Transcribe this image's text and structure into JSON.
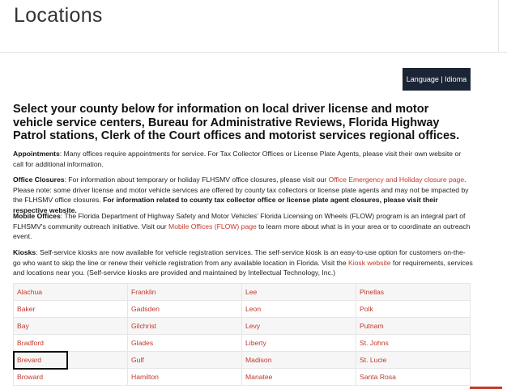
{
  "page": {
    "title": "Locations"
  },
  "language_button": {
    "label": "Language | Idioma"
  },
  "intro_heading": "Select your county below for information on local driver license and motor vehicle service centers, Bureau for Administrative Reviews, Florida Highway Patrol stations, Clerk of the Court offices and motorist services regional offices.",
  "appointments": {
    "label": "Appointments",
    "text": ": Many offices require appointments for service. For Tax Collector Offices or License Plate Agents, please visit their own website or call for additional information."
  },
  "office_closures": {
    "label": "Office Closures",
    "text_before": ": For information about temporary or holiday FLHSMV office closures, please visit our ",
    "link": "Office Emergency and Holiday closure page",
    "text_after": ". Please note: some driver license and motor vehicle services are offered by county tax collectors or license plate agents and may not be impacted by the FLHSMV office closures. ",
    "bold_note": "For information related to county tax collector office or license plate agent closures, please visit their respective website."
  },
  "mobile_offices": {
    "label": "Mobile Offices",
    "text_before": ": The Florida Department of Highway Safety and Motor Vehicles' Florida Licensing on Wheels (FLOW) program is an integral part of FLHSMV's community outreach initiative. Visit our ",
    "link": "Mobile Offices (FLOW) page",
    "text_after": " to learn more about what is in your area or to coordinate an outreach event."
  },
  "kiosks": {
    "label": "Kiosks",
    "text_before": ": Self-service kiosks are now available for vehicle registration services. The self-service kiosk is an easy-to-use option for customers on-the-go who want to skip the line or renew their vehicle registration from any available location in Florida. Visit the ",
    "link": "Kiosk website",
    "text_after": " for requirements, services and locations near you. (Self-service kiosks are provided and maintained by Intellectual Technology, Inc.)"
  },
  "counties": [
    [
      "Alachua",
      "Franklin",
      "Lee",
      "Pinellas"
    ],
    [
      "Baker",
      "Gadsden",
      "Leon",
      "Polk"
    ],
    [
      "Bay",
      "Gilchrist",
      "Levy",
      "Putnam"
    ],
    [
      "Bradford",
      "Glades",
      "Liberty",
      "St. Johns"
    ],
    [
      "Brevard",
      "Gulf",
      "Madison",
      "St. Lucie"
    ],
    [
      "Broward",
      "Hamilton",
      "Manatee",
      "Santa Rosa"
    ]
  ],
  "colors": {
    "link": "#c0392b",
    "button_bg": "#1b2535"
  }
}
